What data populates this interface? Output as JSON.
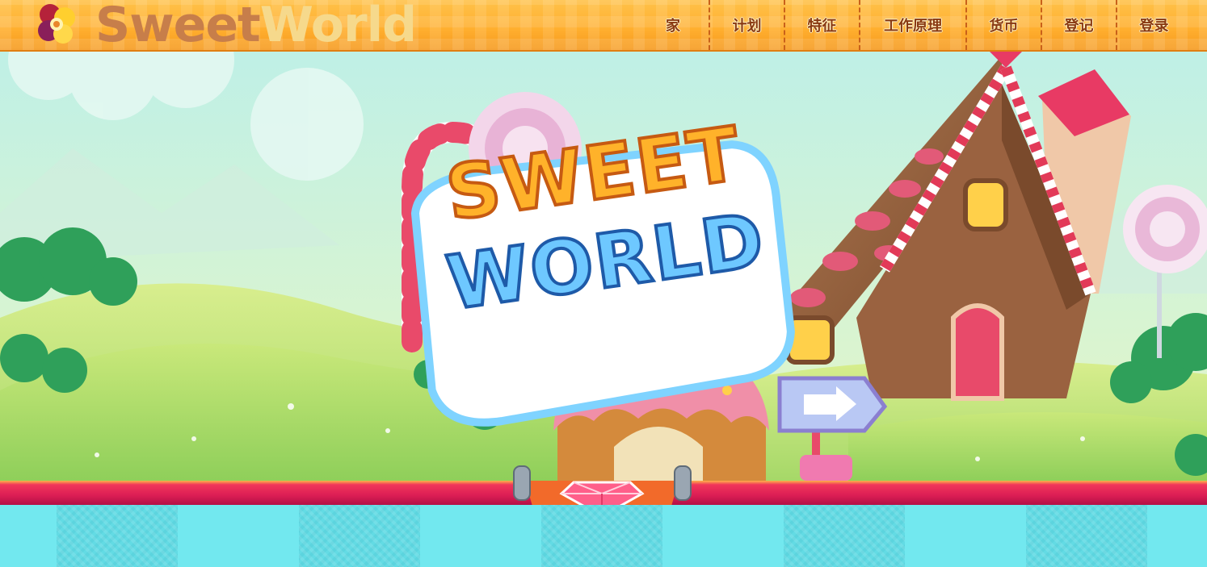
{
  "brand": {
    "word1": "Sweet",
    "word2": "World",
    "logo_icon": "candy-flower-icon"
  },
  "nav": {
    "items": [
      {
        "label": "家"
      },
      {
        "label": "计划"
      },
      {
        "label": "特征"
      },
      {
        "label": "工作原理"
      },
      {
        "label": "货币"
      },
      {
        "label": "登记"
      },
      {
        "label": "登录"
      }
    ]
  },
  "hero": {
    "title_line1": "SWEET",
    "title_line2": "WORLD"
  },
  "colors": {
    "header": "#ffae2e",
    "nav_text": "#8a3a12",
    "ribbon": "#dc1e55",
    "bottom": "#72e8ef",
    "sky": "#bdeee4",
    "grass": "#a9d86a"
  }
}
